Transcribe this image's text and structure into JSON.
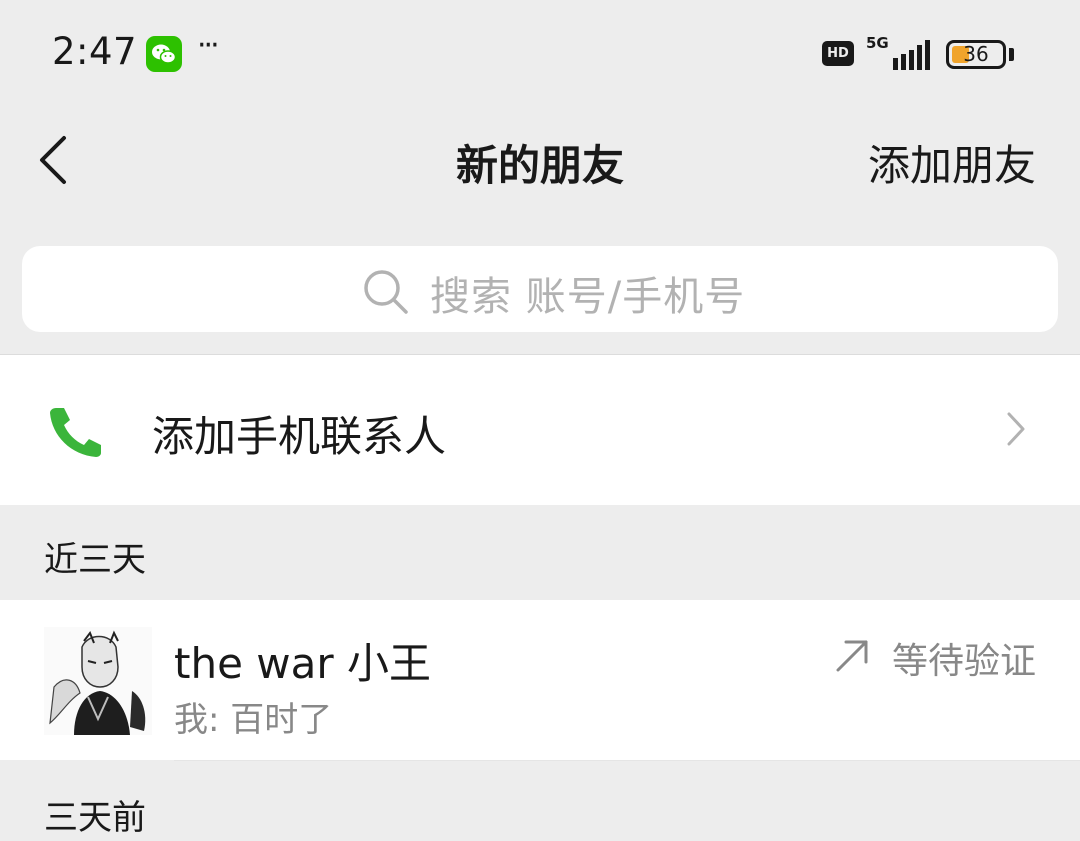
{
  "status_bar": {
    "time": "2:47",
    "more": "···",
    "hd": "HD",
    "network": "5G",
    "battery": "36",
    "battery_level": 0.36
  },
  "nav": {
    "title": "新的朋友",
    "action": "添加朋友"
  },
  "search": {
    "placeholder": "搜索 账号/手机号"
  },
  "add_phone_contacts": {
    "label": "添加手机联系人"
  },
  "sections": [
    {
      "header": "近三天",
      "items": [
        {
          "name": "the war 小王",
          "message": "我: 百时了",
          "status": "等待验证"
        }
      ]
    },
    {
      "header": "三天前",
      "items": []
    }
  ],
  "colors": {
    "background": "#ededed",
    "wechat_green": "#2dc100",
    "phone_green": "#3bb53b",
    "battery": "#f0a42c",
    "secondary_text": "#888888"
  }
}
